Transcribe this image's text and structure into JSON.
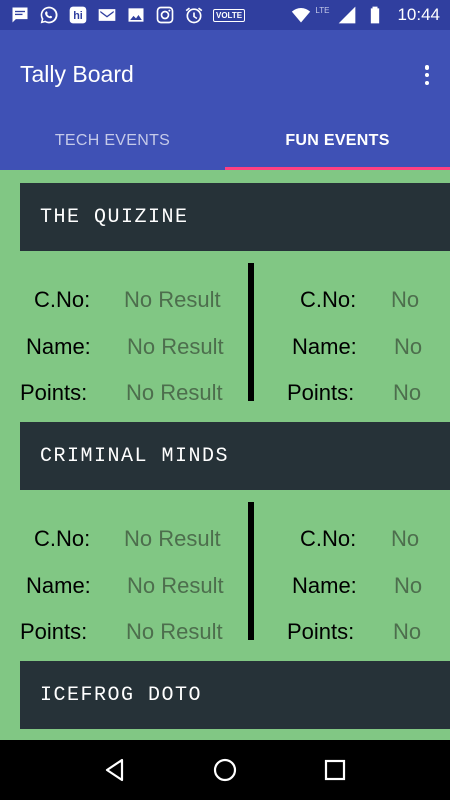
{
  "status_bar": {
    "icons": [
      "message-icon",
      "whatsapp-icon",
      "hike-icon",
      "gmail-icon",
      "image-icon",
      "instagram-icon",
      "alarm-icon",
      "volte-icon",
      "wifi-icon",
      "signal-icon",
      "battery-icon"
    ],
    "volte": "VOLTE",
    "lte": "LTE",
    "time": "10:44"
  },
  "app_bar": {
    "title": "Tally Board",
    "tabs": [
      {
        "label": "TECH EVENTS",
        "active": false
      },
      {
        "label": "FUN EVENTS",
        "active": true
      }
    ],
    "accent": "#ff4081",
    "primary": "#3f51b5"
  },
  "events": [
    {
      "name": "THE QUIZINE",
      "left": {
        "cno_label": "C.No:",
        "cno": "No Result",
        "name_label": "Name:",
        "name": "No Result",
        "points_label": "Points:",
        "points": "No Result"
      },
      "right": {
        "cno_label": "C.No:",
        "cno": "No",
        "name_label": "Name:",
        "name": "No",
        "points_label": "Points:",
        "points": "No"
      }
    },
    {
      "name": "CRIMINAL MINDS",
      "left": {
        "cno_label": "C.No:",
        "cno": "No Result",
        "name_label": "Name:",
        "name": "No Result",
        "points_label": "Points:",
        "points": "No Result"
      },
      "right": {
        "cno_label": "C.No:",
        "cno": "No",
        "name_label": "Name:",
        "name": "No",
        "points_label": "Points:",
        "points": "No"
      }
    },
    {
      "name": "ICEFROG DOTO"
    }
  ],
  "background": "#81c784"
}
